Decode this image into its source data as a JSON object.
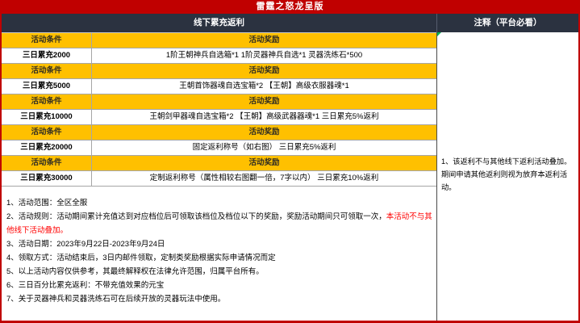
{
  "title": "雷霆之怒龙呈版",
  "left_header": "线下累充返利",
  "right_header": "注释（平台必看）",
  "table": {
    "condition_header": "活动条件",
    "reward_header": "活动奖励",
    "rows": [
      {
        "condition": "三日累充2000",
        "reward": "1阶王朝神兵自选箱*1 1阶灵器神兵自选*1 灵器洗练石*500"
      },
      {
        "condition": "三日累充5000",
        "reward": "王朝首饰器魂自选宝箱*2 【王朝】高级衣服器魂*1"
      },
      {
        "condition": "三日累充10000",
        "reward": "王朝剑甲器魂自选宝箱*2 【王朝】高级武器器魂*1 三日累充5%返利"
      },
      {
        "condition": "三日累充20000",
        "reward": "固定返利称号（如右图） 三日累充5%返利"
      },
      {
        "condition": "三日累充30000",
        "reward": "定制返利称号（属性相较右图翻一倍，7字以内） 三日累充10%返利"
      }
    ]
  },
  "notes": [
    {
      "text": "1、活动范围：全区全服",
      "red": ""
    },
    {
      "text": "2、活动规则：活动期间累计充值达到对应档位后可领取该档位及档位以下的奖励，奖励活动期间只可领取一次，",
      "red": "本活动不与其他线下活动叠加。"
    },
    {
      "text": "3、活动日期：2023年9月22日-2023年9月24日",
      "red": ""
    },
    {
      "text": "4、领取方式：活动结束后，3日内邮件领取，定制类奖励根据实际申请情况而定",
      "red": ""
    },
    {
      "text": "5、以上活动内容仅供参考，其最终解释权在法律允许范围，归属平台所有。",
      "red": ""
    },
    {
      "text": "6、三日百分比累充返利：不带充值效果的元宝",
      "red": ""
    },
    {
      "text": "7、关于灵器神兵和灵器洗练石可在后续开放的灵器玩法中使用。",
      "red": ""
    }
  ],
  "annotation": {
    "note": "1、该返利不与其他线下返利活动叠加。期间申请其他返利则视为放弃本返利活动。"
  },
  "colors": {
    "accent_red": "#c00000",
    "header_navy": "#2b3240",
    "tier_gold": "#ffc000",
    "warning_red_text": "#ff0000",
    "comment_marker_green": "#00b050"
  }
}
